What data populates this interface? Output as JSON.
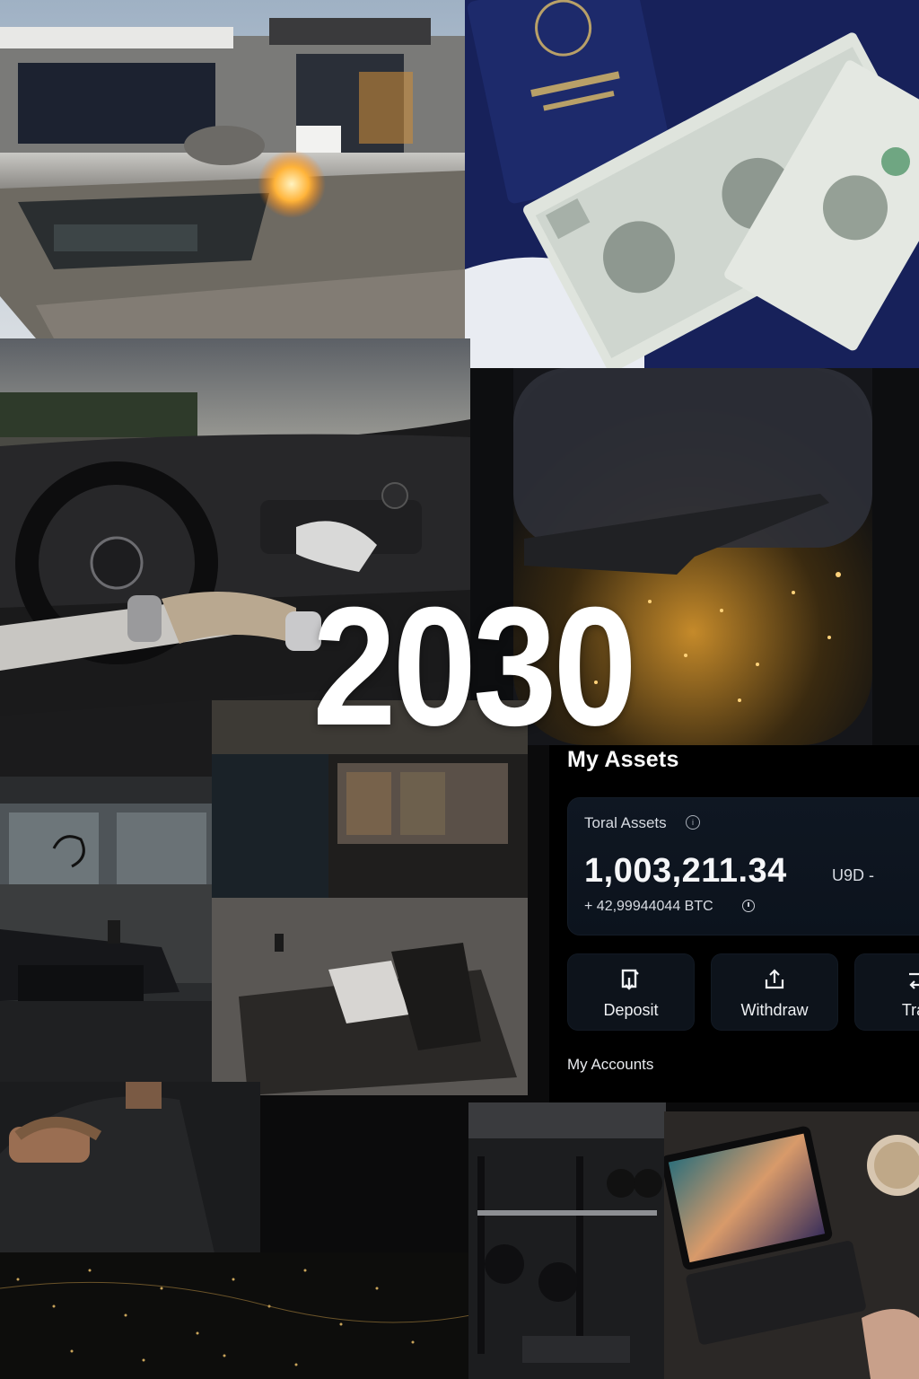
{
  "title": "2030",
  "assets_panel": {
    "heading": "My Assets",
    "total_label": "Toral Assets",
    "total_value": "1,003,211.34",
    "currency": "U9D -",
    "btc_value": "+ 42,99944044 BTC",
    "actions": [
      {
        "label": "Deposit",
        "icon": "deposit-icon"
      },
      {
        "label": "Withdraw",
        "icon": "upload-icon"
      },
      {
        "label": "Tran",
        "icon": "transfer-icon"
      }
    ],
    "accounts_heading": "My Accounts"
  },
  "colors": {
    "panel_bg": "#000000",
    "card_bg": "#0f1722",
    "button_bg": "#0d131b",
    "text": "#ffffff"
  }
}
